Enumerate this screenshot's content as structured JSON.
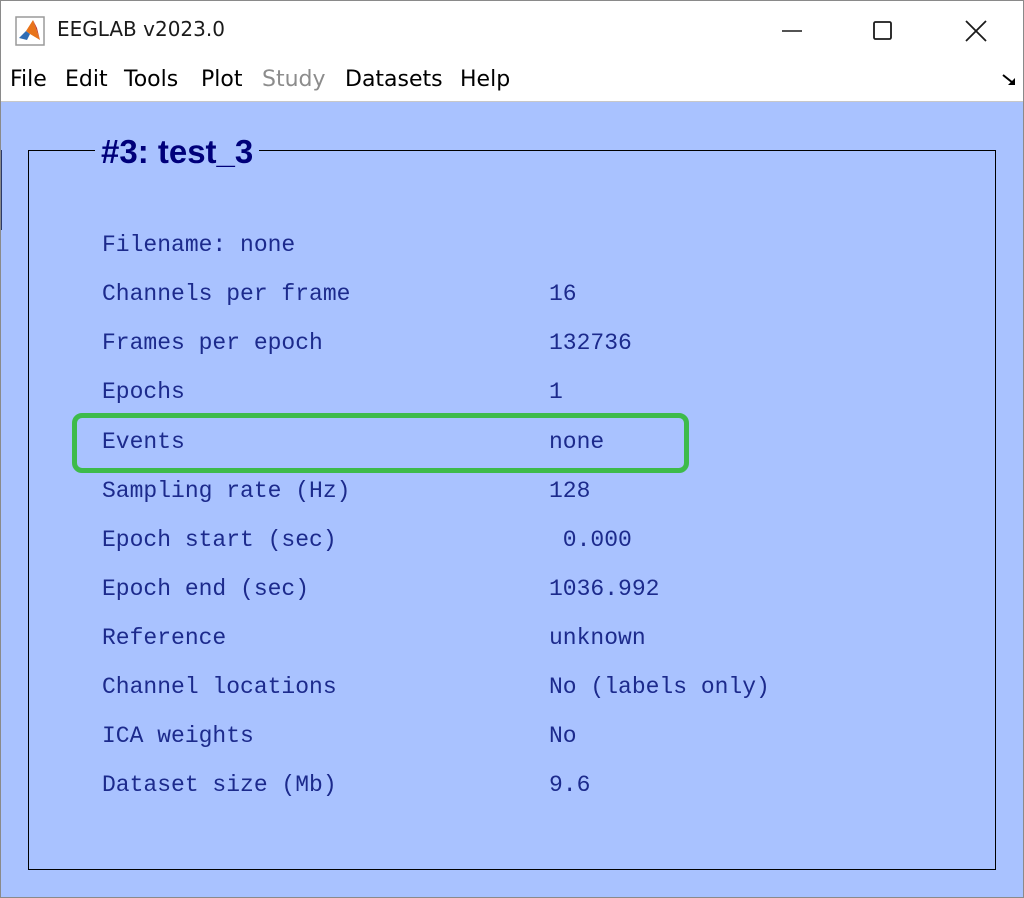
{
  "window": {
    "title": "EEGLAB v2023.0",
    "icons": {
      "app": "matlab-icon",
      "minimize": "minimize-icon",
      "maximize": "maximize-icon",
      "close": "close-icon",
      "dock": "dock-arrow-icon"
    }
  },
  "menubar": {
    "file": "File",
    "edit": "Edit",
    "tools": "Tools",
    "plot": "Plot",
    "study": "Study",
    "datasets": "Datasets",
    "help": "Help"
  },
  "dataset": {
    "title": "#3: test_3",
    "filename": "Filename: none",
    "rows": [
      {
        "label": "Channels per frame",
        "value": "16"
      },
      {
        "label": "Frames per epoch",
        "value": "132736"
      },
      {
        "label": "Epochs",
        "value": "1"
      },
      {
        "label": "Events",
        "value": "none"
      },
      {
        "label": "Sampling rate (Hz)",
        "value": "128"
      },
      {
        "label": "Epoch start (sec)",
        "value": " 0.000"
      },
      {
        "label": "Epoch end (sec)",
        "value": "1036.992"
      },
      {
        "label": "Reference",
        "value": "unknown"
      },
      {
        "label": "Channel locations",
        "value": "No (labels only)"
      },
      {
        "label": "ICA weights",
        "value": "No"
      },
      {
        "label": "Dataset size (Mb)",
        "value": "9.6"
      }
    ]
  },
  "colors": {
    "panel_background": "#a9c2ff",
    "text": "#1c2a8c",
    "title_text": "#00007a",
    "highlight": "#3dbb4a",
    "disabled_menu": "#8c8c8c"
  }
}
